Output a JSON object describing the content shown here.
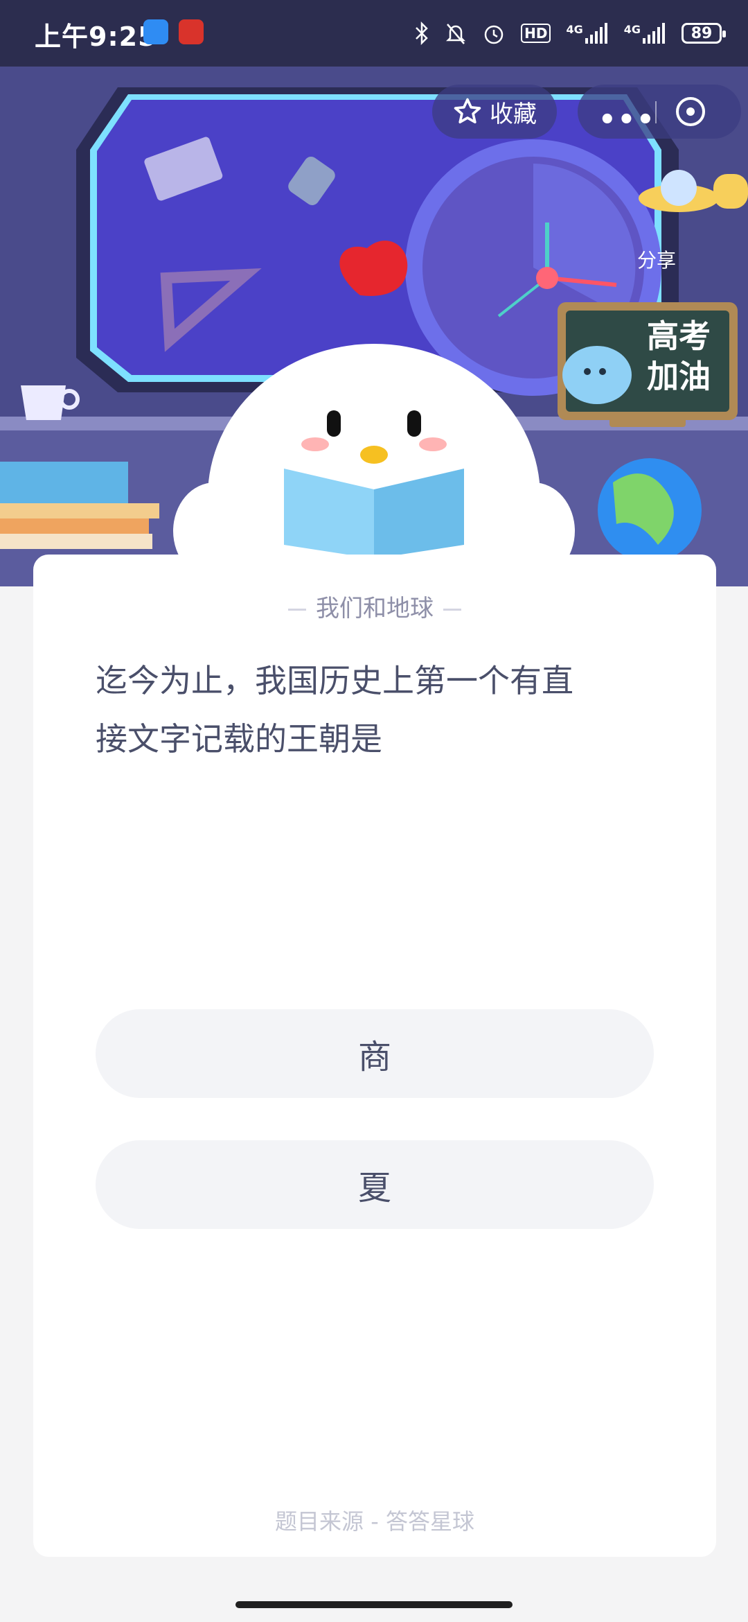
{
  "status_bar": {
    "time": "上午9:25",
    "signal_labels": [
      "HD",
      "4G",
      "4G"
    ],
    "battery": "89"
  },
  "top_bar": {
    "favorite_label": "收藏",
    "share_label": "分享"
  },
  "hero": {
    "blackboard_line1": "高考",
    "blackboard_line2": "加油"
  },
  "quiz": {
    "category": "我们和地球",
    "question_line1": "迄今为止，我国历史上第一个有直",
    "question_line2": "接文字记载的王朝是",
    "options": [
      "商",
      "夏"
    ],
    "source": "题目来源 - 答答星球"
  },
  "colors": {
    "status_bar_bg": "#2c2d4f",
    "hero_bg": "#4a4b8b",
    "card_bg": "#ffffff",
    "option_bg": "#f3f4f7",
    "text_primary": "#4a4f6a"
  }
}
